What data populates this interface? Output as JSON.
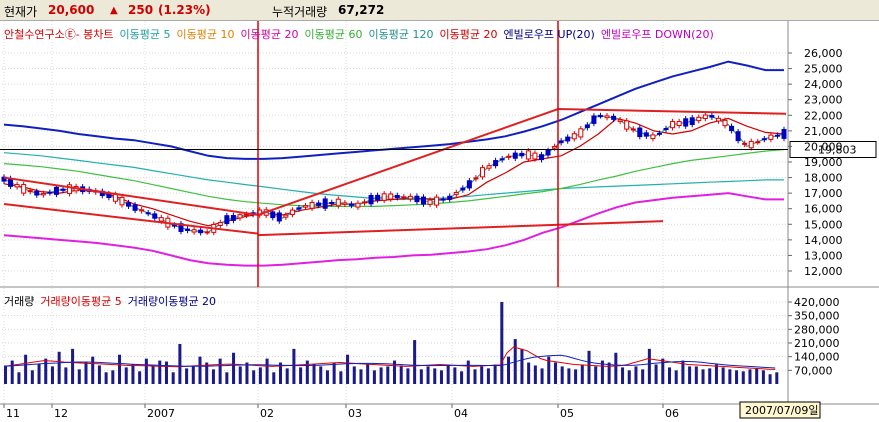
{
  "header": {
    "price_label": "현재가",
    "price_value": "20,600",
    "change_arrow": "▲",
    "change_value": "250",
    "change_pct": "(1.23%)",
    "volume_label": "누적거래량",
    "volume_value": "67,272"
  },
  "price_legend": [
    {
      "text": "안철수연구소Ⓔ- 봉차트",
      "color": "#d00000"
    },
    {
      "text": "이동평균 5",
      "color": "#20a0a0"
    },
    {
      "text": "이동평균 10",
      "color": "#e08000"
    },
    {
      "text": "이동평균 20",
      "color": "#d000a0"
    },
    {
      "text": "이동평균 60",
      "color": "#30b030"
    },
    {
      "text": "이동평균 120",
      "color": "#209090"
    },
    {
      "text": "이동평균 20",
      "color": "#d00000"
    },
    {
      "text": "엔빌로우프 UP(20)",
      "color": "#000080"
    },
    {
      "text": "엔빌로우프 DOWN(20)",
      "color": "#c000c0"
    }
  ],
  "volume_legend": [
    {
      "text": "거래량",
      "color": "#000000"
    },
    {
      "text": "거래량이동평균 5",
      "color": "#d00000"
    },
    {
      "text": "거래량이동평균 20",
      "color": "#000080"
    }
  ],
  "current_price_tag": "19,803",
  "date_tag": "2007/07/09일",
  "x_labels": [
    "11",
    "12",
    "2007",
    "02",
    "03",
    "04",
    "05",
    "06"
  ],
  "price_ticks": [
    "26,000",
    "25,000",
    "24,000",
    "23,000",
    "22,000",
    "21,000",
    "20,000",
    "19,000",
    "18,000",
    "17,000",
    "16,000",
    "15,000",
    "14,000",
    "13,000",
    "12,000"
  ],
  "volume_ticks": [
    "420,000",
    "350,000",
    "280,000",
    "210,000",
    "140,000",
    "70,000"
  ],
  "chart_data": {
    "type": "line",
    "title": "안철수연구소Ⓔ- 봉차트",
    "x_range": [
      "2006-11",
      "2007-07-09"
    ],
    "price_axis": {
      "min": 12000,
      "max": 26000
    },
    "volume_axis": {
      "min": 0,
      "max": 420000
    },
    "series": [
      {
        "name": "엔빌로우프 UP(20)",
        "color": "#1020c0",
        "values": [
          21400,
          21300,
          21150,
          21000,
          20800,
          20650,
          20500,
          20400,
          20200,
          20000,
          19700,
          19400,
          19250,
          19200,
          19200,
          19250,
          19350,
          19450,
          19550,
          19650,
          19750,
          19850,
          19950,
          20050,
          20150,
          20300,
          20450,
          20650,
          20950,
          21300,
          21700,
          22200,
          22700,
          23200,
          23700,
          24100,
          24500,
          24800,
          25100,
          25450,
          25200,
          24900,
          24900
        ]
      },
      {
        "name": "엔빌로우프 DOWN(20)",
        "color": "#e020e0",
        "values": [
          14300,
          14200,
          14100,
          14000,
          13900,
          13800,
          13650,
          13500,
          13300,
          13000,
          12700,
          12500,
          12400,
          12350,
          12350,
          12400,
          12500,
          12600,
          12700,
          12750,
          12850,
          12900,
          13000,
          13050,
          13150,
          13250,
          13400,
          13650,
          14000,
          14450,
          14800,
          15250,
          15700,
          16100,
          16400,
          16550,
          16700,
          16800,
          16900,
          17000,
          16800,
          16600,
          16600
        ]
      },
      {
        "name": "이동평균 120",
        "color": "#20b0b0",
        "values": [
          19600,
          19500,
          19400,
          19250,
          19100,
          18950,
          18800,
          18650,
          18450,
          18250,
          18050,
          17850,
          17700,
          17550,
          17400,
          17250,
          17100,
          16950,
          16850,
          16750,
          16650,
          16600,
          16600,
          16650,
          16700,
          16800,
          16900,
          17000,
          17100,
          17200,
          17300,
          17350,
          17400,
          17450,
          17500,
          17550,
          17600,
          17650,
          17700,
          17750,
          17800,
          17850,
          17850
        ]
      },
      {
        "name": "이동평균 60",
        "color": "#40c040",
        "values": [
          18900,
          18800,
          18700,
          18550,
          18400,
          18200,
          18000,
          17800,
          17550,
          17300,
          17050,
          16800,
          16600,
          16450,
          16350,
          16250,
          16200,
          16150,
          16150,
          16150,
          16150,
          16200,
          16250,
          16300,
          16400,
          16500,
          16650,
          16800,
          16950,
          17100,
          17300,
          17550,
          17850,
          18100,
          18400,
          18650,
          18900,
          19100,
          19250,
          19400,
          19550,
          19700,
          19800
        ]
      },
      {
        "name": "이동평균 20",
        "color": "#d00000",
        "values": [
          17600,
          17400,
          17100,
          17000,
          17200,
          17100,
          16800,
          16300,
          16000,
          15600,
          15200,
          14900,
          15200,
          15500,
          15700,
          15600,
          15900,
          16100,
          16300,
          16300,
          16500,
          16600,
          16700,
          16600,
          16600,
          16900,
          17700,
          18300,
          19000,
          19200,
          19400,
          20000,
          20800,
          21800,
          21500,
          21000,
          20800,
          21000,
          21500,
          21800,
          21300,
          20900,
          20800
        ]
      },
      {
        "name": "이동평균 5",
        "color": "#30a0a0",
        "values": [
          17900,
          17300,
          16900,
          17200,
          17300,
          17100,
          16700,
          16100,
          15600,
          15000,
          14600,
          14500,
          15300,
          15600,
          15800,
          15400,
          16100,
          16300,
          16400,
          16200,
          16700,
          16800,
          16700,
          16400,
          16700,
          17500,
          18600,
          19300,
          19500,
          19300,
          20300,
          20800,
          22000,
          21800,
          21000,
          20600,
          21400,
          21600,
          22000,
          21400,
          20000,
          20500,
          20800
        ]
      }
    ],
    "trendlines": [
      {
        "from": [
          "2006-11",
          16300
        ],
        "to": [
          "2007-02",
          14400
        ],
        "color": "#e02020"
      },
      {
        "from": [
          "2006-11",
          18000
        ],
        "to": [
          "2007-02",
          15600
        ],
        "color": "#e02020"
      },
      {
        "from": [
          "2007-02",
          14300
        ],
        "to": [
          "2007-06",
          15200
        ],
        "color": "#e02020"
      },
      {
        "from": [
          "2007-02",
          15600
        ],
        "to": [
          "2007-05",
          22400
        ],
        "color": "#e02020"
      },
      {
        "from": [
          "2007-05",
          22400
        ],
        "to": [
          "2007-07-09",
          22100
        ],
        "color": "#e02020"
      }
    ],
    "vertical_markers": [
      "2007-02",
      "2007-05"
    ],
    "volume_bars": [
      95,
      120,
      60,
      150,
      70,
      105,
      130,
      90,
      165,
      85,
      180,
      75,
      110,
      140,
      95,
      60,
      70,
      150,
      85,
      100,
      65,
      130,
      90,
      120,
      115,
      60,
      205,
      80,
      95,
      140,
      110,
      75,
      130,
      60,
      160,
      90,
      110,
      70,
      85,
      130,
      60,
      110,
      80,
      180,
      85,
      120,
      100,
      90,
      70,
      110,
      65,
      150,
      90,
      75,
      100,
      70,
      85,
      90,
      120,
      95,
      80,
      225,
      75,
      90,
      80,
      70,
      100,
      85,
      65,
      120,
      75,
      90,
      80,
      100,
      420,
      140,
      230,
      180,
      110,
      95,
      80,
      140,
      110,
      90,
      80,
      75,
      100,
      170,
      90,
      120,
      110,
      160,
      85,
      70,
      90,
      75,
      180,
      100,
      130,
      85,
      70,
      120,
      90,
      90,
      75,
      80,
      100,
      85,
      75,
      70,
      65,
      75,
      80,
      70,
      50,
      60
    ],
    "volume_ma5": [
      90,
      95,
      100,
      105,
      110,
      115,
      120,
      118,
      115,
      112,
      110,
      108,
      106,
      105,
      104,
      102,
      100,
      98,
      96,
      95,
      94,
      93,
      92,
      91,
      90,
      89,
      88,
      90,
      92,
      94,
      96,
      98,
      100,
      101,
      102,
      100,
      98,
      96,
      94,
      92,
      90,
      92,
      94,
      96,
      98,
      100,
      102,
      104,
      106,
      108,
      110,
      108,
      106,
      104,
      102,
      100,
      98,
      96,
      94,
      92,
      90,
      92,
      94,
      96,
      98,
      100,
      98,
      96,
      94,
      92,
      90,
      92,
      94,
      96,
      98,
      160,
      190,
      180,
      170,
      150,
      130,
      120,
      115,
      110,
      105,
      100,
      98,
      96,
      94,
      92,
      90,
      92,
      94,
      100,
      110,
      120,
      130,
      125,
      120,
      115,
      110,
      105,
      100,
      98,
      96,
      94,
      92,
      90,
      88,
      86,
      84,
      82,
      80,
      78,
      76,
      75
    ]
  }
}
